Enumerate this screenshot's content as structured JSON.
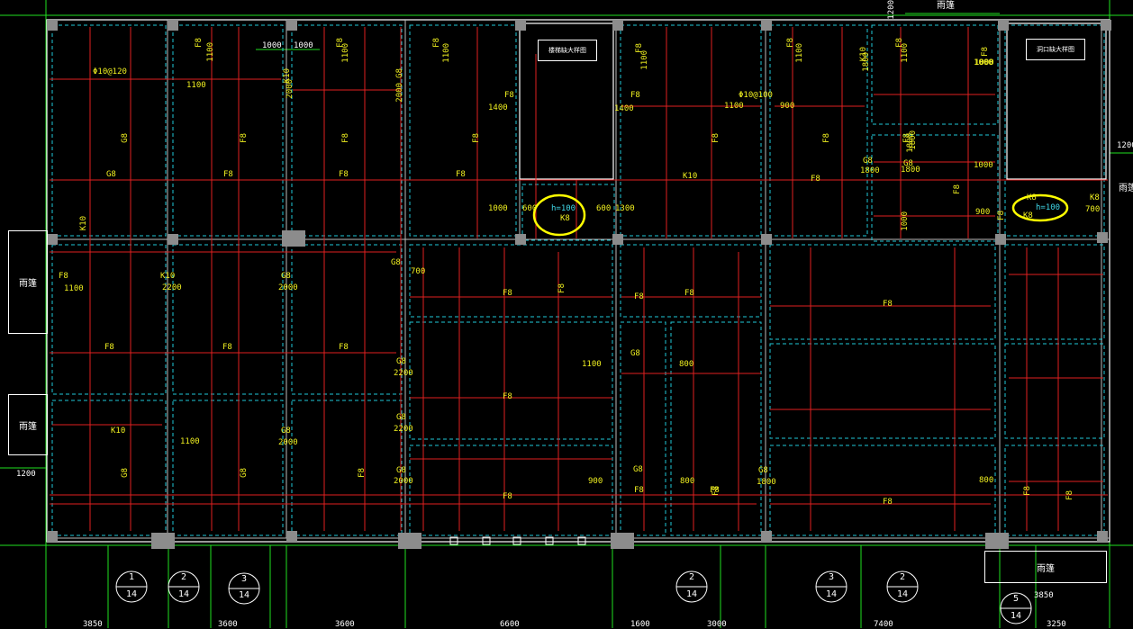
{
  "colors": {
    "background": "#000000",
    "rebar": "#e02020",
    "dashed": "#20c8d8",
    "beam": "#ffffff",
    "text": "#f0f020",
    "axis": "#20e020",
    "highlight": "#ffff00"
  },
  "notes": {
    "hole_left": "楼梯缺大样图",
    "hole_right": "洞口缺大样图",
    "canopy_top": "雨篷",
    "canopy_left1": "雨篷",
    "canopy_left2": "雨篷",
    "canopy_right": "雨篷",
    "canopy_bottom": "雨篷",
    "dim_left_1200": "1200",
    "dim_top_1200": "1200",
    "dim_right_1200": "1200",
    "hl_left": "h=100",
    "hl_left_k": "K8",
    "hl_right": "h=100",
    "hl_right_k": "K8"
  },
  "axis_bubbles": [
    {
      "top": "1",
      "bottom": "14"
    },
    {
      "top": "2",
      "bottom": "14"
    },
    {
      "top": "3",
      "bottom": "14"
    },
    {
      "top": "2",
      "bottom": "14"
    },
    {
      "top": "3",
      "bottom": "14"
    },
    {
      "top": "2",
      "bottom": "14"
    },
    {
      "top": "5",
      "bottom": "14"
    }
  ],
  "bottom_dims": [
    "3850",
    "3600",
    "3600",
    "6600",
    "1600",
    "3000",
    "7400",
    "3250",
    "3850"
  ],
  "top_dims": [
    "1000",
    "1000"
  ],
  "labels": [
    {
      "t": "F8"
    },
    {
      "t": "1100"
    },
    {
      "t": "F8"
    },
    {
      "t": "1100"
    },
    {
      "t": "F8"
    },
    {
      "t": "1100"
    },
    {
      "t": "F8"
    },
    {
      "t": "1100"
    },
    {
      "t": "Φ10@120"
    },
    {
      "t": "1100"
    },
    {
      "t": "K10"
    },
    {
      "t": "2000"
    },
    {
      "t": "G8"
    },
    {
      "t": "2000"
    },
    {
      "t": "F8"
    },
    {
      "t": "1100"
    },
    {
      "t": "F8"
    },
    {
      "t": "1100"
    },
    {
      "t": "Φ10@100"
    },
    {
      "t": "1100"
    },
    {
      "t": "900"
    },
    {
      "t": "F8"
    },
    {
      "t": "1400"
    },
    {
      "t": "K10"
    },
    {
      "t": "1800"
    },
    {
      "t": "F8"
    },
    {
      "t": "1000"
    },
    {
      "t": "G8"
    },
    {
      "t": "F8"
    },
    {
      "t": "F8"
    },
    {
      "t": "F8"
    },
    {
      "t": "F8"
    },
    {
      "t": "F8"
    },
    {
      "t": "G8"
    },
    {
      "t": "F8"
    },
    {
      "t": "F8"
    },
    {
      "t": "F8"
    },
    {
      "t": "K10"
    },
    {
      "t": "F8"
    },
    {
      "t": "F8"
    },
    {
      "t": "1800"
    },
    {
      "t": "G8"
    },
    {
      "t": "1800"
    },
    {
      "t": "K10"
    },
    {
      "t": "F8"
    },
    {
      "t": "1100"
    },
    {
      "t": "K10"
    },
    {
      "t": "2200"
    },
    {
      "t": "G8"
    },
    {
      "t": "2000"
    },
    {
      "t": "G8"
    },
    {
      "t": "700"
    },
    {
      "t": "F8"
    },
    {
      "t": "F8"
    },
    {
      "t": "F8"
    },
    {
      "t": "F8"
    },
    {
      "t": "F8"
    },
    {
      "t": "F8"
    },
    {
      "t": "F8"
    },
    {
      "t": "F8"
    },
    {
      "t": "F8"
    },
    {
      "t": "F8"
    },
    {
      "t": "G8"
    },
    {
      "t": "800"
    },
    {
      "t": "1100"
    },
    {
      "t": "G8"
    },
    {
      "t": "2200"
    },
    {
      "t": "K10"
    },
    {
      "t": "1100"
    },
    {
      "t": "G8"
    },
    {
      "t": "2000"
    },
    {
      "t": "G8"
    },
    {
      "t": "2200"
    },
    {
      "t": "G8"
    },
    {
      "t": "G8"
    },
    {
      "t": "F8"
    },
    {
      "t": "F8"
    },
    {
      "t": "F8"
    },
    {
      "t": "F8"
    },
    {
      "t": "G8"
    },
    {
      "t": "2000"
    },
    {
      "t": "900"
    },
    {
      "t": "G8"
    },
    {
      "t": "800"
    },
    {
      "t": "F8"
    },
    {
      "t": "F8"
    },
    {
      "t": "G8"
    },
    {
      "t": "1800"
    },
    {
      "t": "800"
    },
    {
      "t": "F8"
    },
    {
      "t": "F8"
    },
    {
      "t": "1000"
    },
    {
      "t": "600"
    },
    {
      "t": "600"
    },
    {
      "t": "1300"
    },
    {
      "t": "900"
    },
    {
      "t": "700"
    },
    {
      "t": "K8"
    },
    {
      "t": "K8"
    },
    {
      "t": "1000"
    },
    {
      "t": "F8"
    },
    {
      "t": "1400"
    },
    {
      "t": "1800"
    },
    {
      "t": "G8"
    },
    {
      "t": "1800"
    },
    {
      "t": "F8"
    },
    {
      "t": "1000"
    },
    {
      "t": "1000"
    }
  ]
}
